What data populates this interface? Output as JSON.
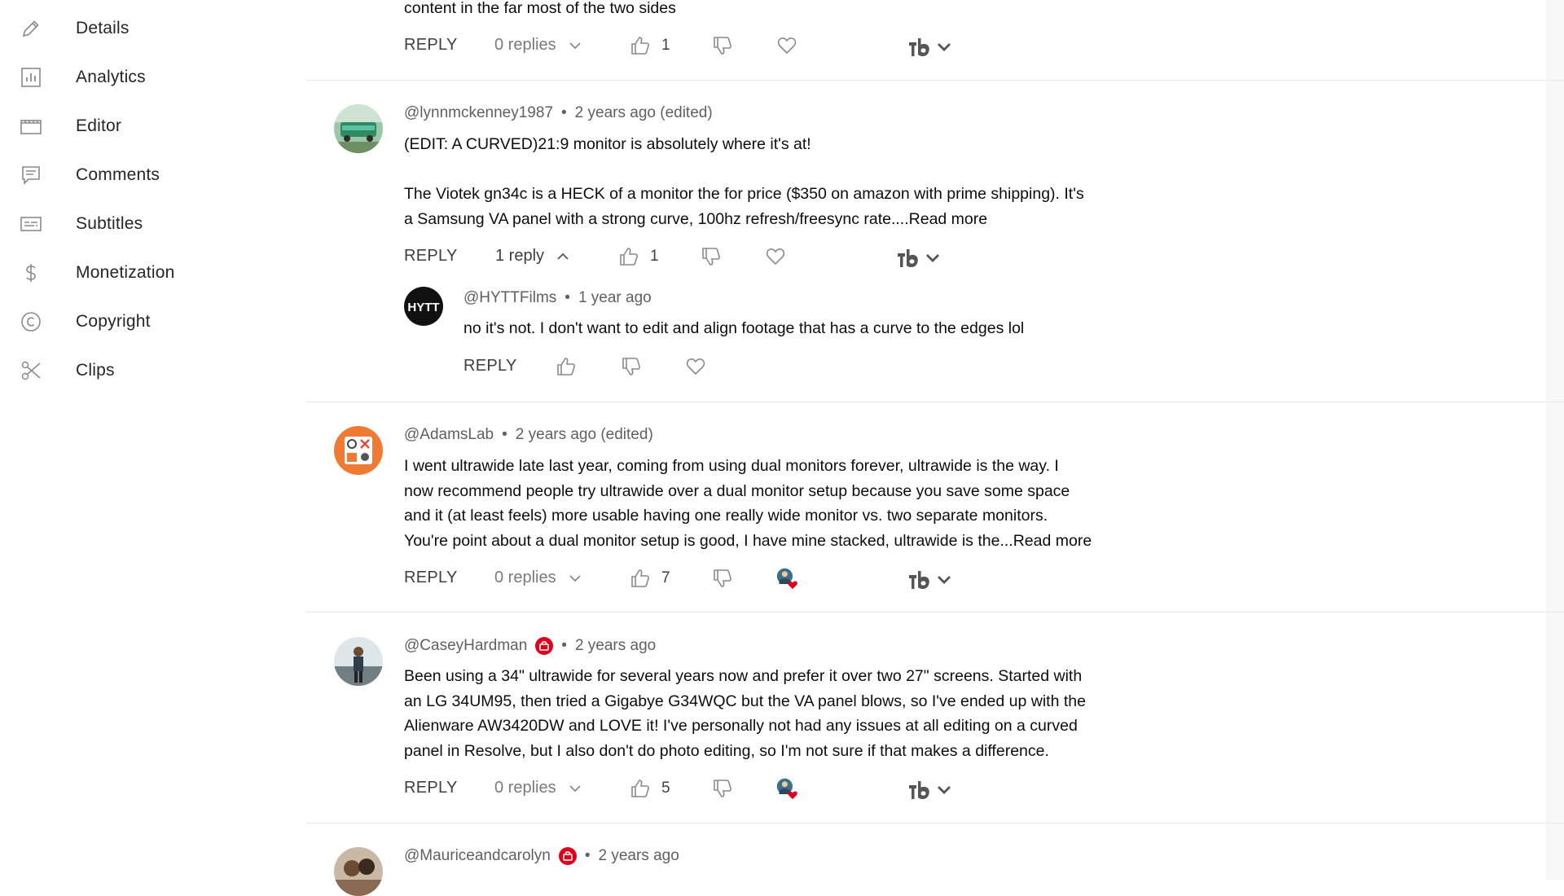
{
  "sidebar": {
    "items": [
      {
        "label": "Details",
        "icon": "pencil-icon"
      },
      {
        "label": "Analytics",
        "icon": "analytics-icon"
      },
      {
        "label": "Editor",
        "icon": "clapperboard-icon"
      },
      {
        "label": "Comments",
        "icon": "comment-icon"
      },
      {
        "label": "Subtitles",
        "icon": "subtitles-icon"
      },
      {
        "label": "Monetization",
        "icon": "dollar-icon"
      },
      {
        "label": "Copyright",
        "icon": "copyright-icon"
      },
      {
        "label": "Clips",
        "icon": "scissors-icon"
      }
    ]
  },
  "comments": {
    "c0": {
      "text_tail": "content in the far most of the two sides",
      "reply_label": "REPLY",
      "replies_label": "0 replies",
      "likes": "1"
    },
    "c1": {
      "author": "@lynnmckenney1987",
      "dot": "•",
      "time": "2 years ago (edited)",
      "line1": "(EDIT: A CURVED)21:9 monitor is absolutely where it's at!",
      "line2": "The Viotek gn34c is a HECK of a monitor the for price ($350 on amazon with prime shipping). It's",
      "line3": "a Samsung VA panel with a strong curve, 100hz refresh/freesync rate....",
      "read_more": "Read more",
      "reply_label": "REPLY",
      "replies_label": "1 reply",
      "likes": "1"
    },
    "r1": {
      "author": "@HYTTFilms",
      "dot": "•",
      "time": "1 year ago",
      "text": "no it's not. I don't want to edit and align footage that has a curve to the edges lol",
      "reply_label": "REPLY",
      "avatar_text": "HYTT"
    },
    "c2": {
      "author": "@AdamsLab",
      "dot": "•",
      "time": "2 years ago (edited)",
      "line1": "I went ultrawide late last year, coming from using dual monitors forever, ultrawide is the way. I",
      "line2": "now recommend people try ultrawide over a dual monitor setup because you save some space",
      "line3": "and it (at least feels) more usable having one really wide monitor vs. two separate monitors.",
      "line4": "You're point about a dual monitor setup is good, I have mine stacked, ultrawide is th\u0000...",
      "line4_text": "You're point about a dual monitor setup is good, I have mine stacked, ultrawide is the...",
      "read_more": "Read more",
      "reply_label": "REPLY",
      "replies_label": "0 replies",
      "likes": "7"
    },
    "c3": {
      "author": "@CaseyHardman",
      "dot": "•",
      "time": "2 years ago",
      "line1": "Been using a 34\" ultrawide for several years now and prefer it over two 27\" screens. Started with",
      "line2": "an LG 34UM95, then tried a Gigabye G34WQC but the VA panel blows, so I've ended up with the",
      "line3": "Alienware AW3420DW and LOVE it! I've personally not had any issues at all editing on a curved",
      "line4": "panel in Resolve, but I also don't do photo editing, so I'm not sure if that makes a difference.",
      "reply_label": "REPLY",
      "replies_label": "0 replies",
      "likes": "5"
    },
    "c4": {
      "author": "@Mauriceandcarolyn",
      "dot": "•",
      "time": "2 years ago"
    }
  },
  "colors": {
    "accent_red": "#e0001b",
    "text_primary": "#0d0d0d",
    "text_secondary": "#606060"
  }
}
